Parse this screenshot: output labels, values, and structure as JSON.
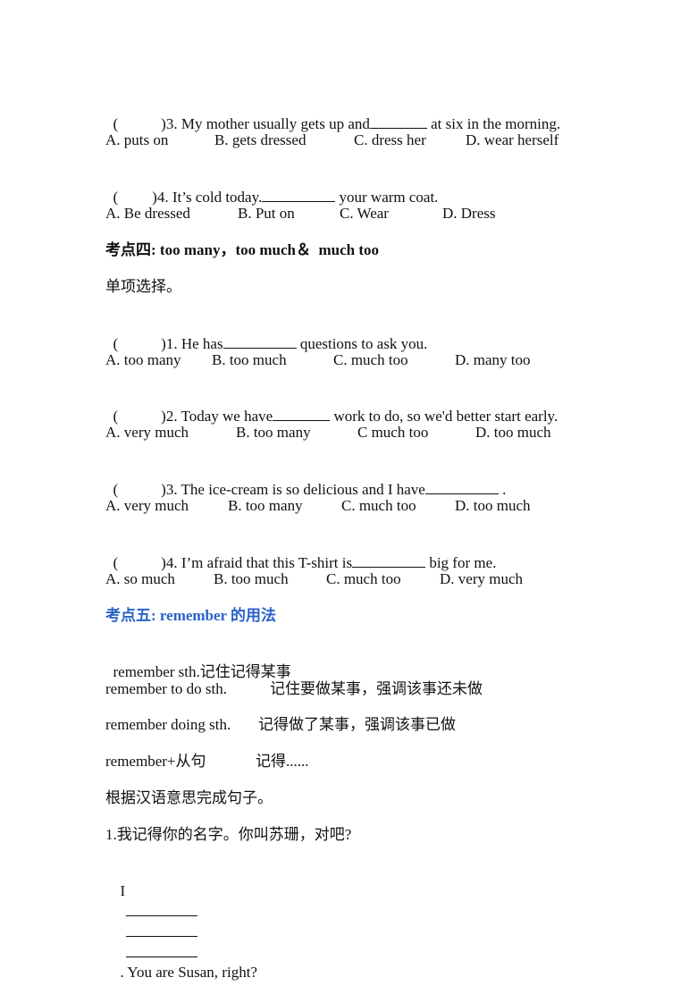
{
  "section3_tail": {
    "q3": {
      "paren": "(",
      "close": ")3. My mother usually gets up and",
      "after": " at six in the morning."
    },
    "q3_options": [
      "A. puts on",
      "B. gets dressed",
      "C. dress her",
      "D. wear herself"
    ],
    "q4": {
      "paren": "(",
      "close": ")4. It’s cold today.",
      "after": " your warm coat."
    },
    "q4_options": [
      "A. Be dressed",
      "B. Put on",
      "C. Wear",
      "D. Dress"
    ]
  },
  "section4": {
    "heading": "考点四: too many，too much＆  much too",
    "instruction": "单项选择。",
    "q1": {
      "paren": "(",
      "close": ")1. He has",
      "after": " questions to ask you."
    },
    "q1_options": [
      "A. too many",
      "B. too much",
      "C. much too",
      "D. many too"
    ],
    "q2": {
      "paren": "(",
      "close": ")2. Today we have",
      "after": " work to do, so we'd better start early."
    },
    "q2_options": [
      "A. very much",
      "B. too many",
      "C much too",
      "D. too much"
    ],
    "q3": {
      "paren": "(",
      "close": ")3. The ice-cream is so delicious and I have",
      "after": " ."
    },
    "q3_options": [
      "A. very much",
      "B. too many",
      "C. much too",
      "D. too much"
    ],
    "q4": {
      "paren": "(",
      "close": ")4. I’m afraid that this T-shirt is",
      "after": " big for me."
    },
    "q4_options": [
      "A. so much",
      "B. too much",
      "C. much too",
      "D. very much"
    ]
  },
  "section5": {
    "heading": "考点五: remember 的用法",
    "heading_color": "#2a62c9",
    "usages": [
      {
        "phrase": "remember sth.",
        "meaning": "记住记得某事"
      },
      {
        "phrase": "remember to do sth.",
        "meaning": "记住要做某事，强调该事还未做"
      },
      {
        "phrase": "remember doing sth.",
        "meaning": "记得做了某事，强调该事已做"
      },
      {
        "phrase": "remember+从句",
        "meaning": "记得......"
      }
    ],
    "instruction": "根据汉语意思完成句子。",
    "q1_prompt": "1.我记得你的名字。你叫苏珊，对吧?",
    "q1_answer": {
      "start": "I",
      "end": ". You are Susan, right?"
    }
  }
}
